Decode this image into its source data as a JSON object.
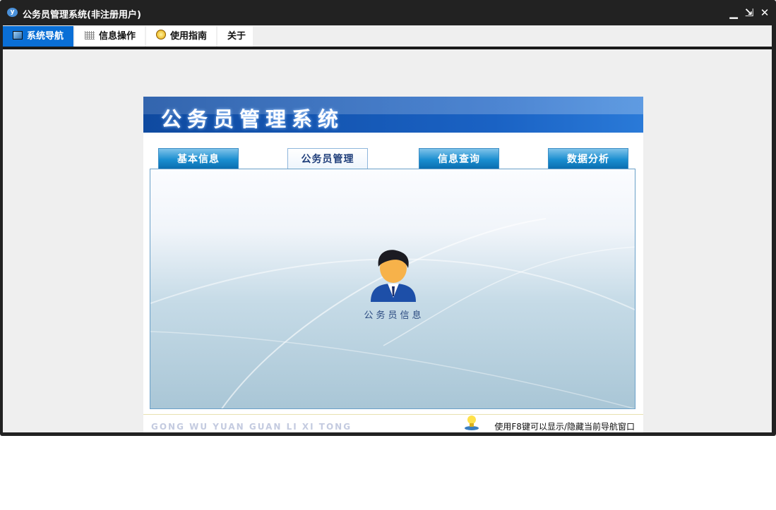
{
  "window": {
    "title": "公务员管理系统(非注册用户)",
    "controls": {
      "minimize": "▁",
      "restore": "⇲",
      "close": "✕"
    }
  },
  "menu": {
    "tabs": [
      {
        "label": "系统导航",
        "icon": "monitor-icon",
        "active": true
      },
      {
        "label": "信息操作",
        "icon": "grid-icon"
      },
      {
        "label": "使用指南",
        "icon": "help-icon"
      },
      {
        "label": "关于"
      }
    ]
  },
  "panel": {
    "banner_title": "公务员管理系统",
    "tabs": [
      {
        "label": "基本信息"
      },
      {
        "label": "公务员管理",
        "active": true
      },
      {
        "label": "信息查询"
      },
      {
        "label": "数据分析"
      }
    ],
    "items": [
      {
        "label": "公务员信息",
        "icon": "person-icon"
      }
    ],
    "footer": {
      "pinyin": "GONG WU YUAN GUAN LI XI TONG",
      "hint": "使用F8键可以显示/隐藏当前导航窗口"
    }
  }
}
